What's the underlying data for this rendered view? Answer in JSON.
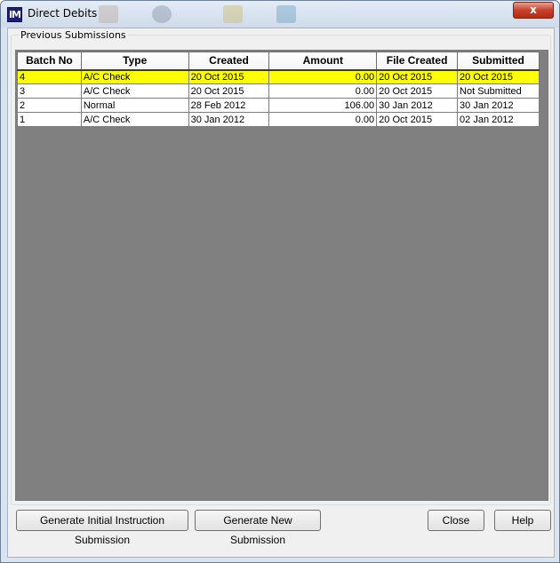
{
  "window": {
    "title": "Direct Debits",
    "app_icon_text": "IM",
    "close_glyph": "x"
  },
  "group": {
    "label": "Previous Submissions"
  },
  "table": {
    "columns": [
      "Batch No",
      "Type",
      "Created",
      "Amount",
      "File Created",
      "Submitted"
    ],
    "rows": [
      {
        "batch_no": "4",
        "type": "A/C Check",
        "created": "20 Oct 2015",
        "amount": "0.00",
        "file_created": "20 Oct 2015",
        "submitted": "20 Oct 2015",
        "selected": true
      },
      {
        "batch_no": "3",
        "type": "A/C Check",
        "created": "20 Oct 2015",
        "amount": "0.00",
        "file_created": "20 Oct 2015",
        "submitted": "Not Submitted",
        "selected": false
      },
      {
        "batch_no": "2",
        "type": "Normal",
        "created": "28 Feb 2012",
        "amount": "106.00",
        "file_created": "30 Jan 2012",
        "submitted": "30 Jan 2012",
        "selected": false
      },
      {
        "batch_no": "1",
        "type": "A/C Check",
        "created": "30 Jan 2012",
        "amount": "0.00",
        "file_created": "20 Oct 2015",
        "submitted": "02 Jan 2012",
        "selected": false
      }
    ]
  },
  "buttons": {
    "generate_initial": "Generate Initial Instruction Submission",
    "generate_new": "Generate New Submission",
    "close": "Close",
    "help": "Help"
  },
  "colors": {
    "selected_row": "#ffff00",
    "grid_background": "#808080",
    "title_close": "#c7412b"
  }
}
